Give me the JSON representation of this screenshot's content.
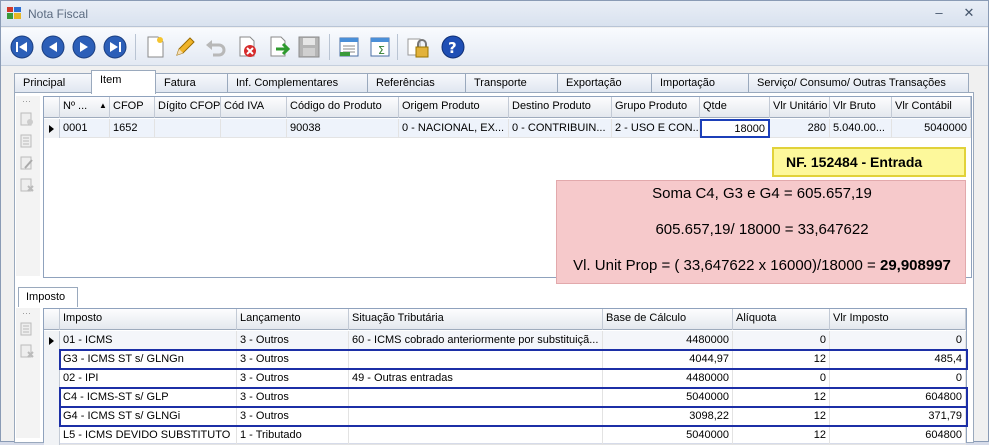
{
  "window": {
    "title": "Nota Fiscal",
    "minimize": "‒",
    "close": "✕"
  },
  "toolbar": {
    "buttons": [
      {
        "icon": "first-record-icon"
      },
      {
        "icon": "previous-record-icon"
      },
      {
        "icon": "next-record-icon"
      },
      {
        "icon": "last-record-icon"
      },
      {
        "icon": "new-document-icon"
      },
      {
        "icon": "edit-pencil-icon"
      },
      {
        "icon": "undo-icon"
      },
      {
        "icon": "delete-icon"
      },
      {
        "icon": "confirm-icon"
      },
      {
        "icon": "save-disk-icon"
      },
      {
        "icon": "report-icon"
      },
      {
        "icon": "sum-report-icon"
      },
      {
        "icon": "lock-icon"
      },
      {
        "icon": "help-icon"
      }
    ]
  },
  "tabs": [
    {
      "label": "Principal"
    },
    {
      "label": "Item"
    },
    {
      "label": "Fatura"
    },
    {
      "label": "Inf. Complementares"
    },
    {
      "label": "Referências"
    },
    {
      "label": "Transporte"
    },
    {
      "label": "Exportação"
    },
    {
      "label": "Importação"
    },
    {
      "label": "Serviço/ Consumo/ Outras Transações"
    }
  ],
  "item_grid": {
    "columns": [
      "Nº ...",
      "CFOP",
      "Dígito CFOP",
      "Cód IVA",
      "Código do Produto",
      "Origem Produto",
      "Destino Produto",
      "Grupo Produto",
      "Qtde",
      "Vlr Unitário",
      "Vlr Bruto",
      "Vlr Contábil"
    ],
    "rows": [
      [
        "0001",
        "1652",
        "",
        "",
        "90038",
        "0 - NACIONAL, EX...",
        "0 - CONTRIBUIN...",
        "2 - USO E CON...",
        "18000",
        "280",
        "5.040.00...",
        "5040000"
      ]
    ]
  },
  "annotation": {
    "banner": "NF. 152484 - Entrada",
    "line1": "Soma C4, G3 e G4 = 605.657,19",
    "line2": "605.657,19/ 18000 = 33,647622",
    "line3_prefix": "Vl. Unit Prop = ( 33,647622 x 16000)/18000 = ",
    "line3_result": "29,908997"
  },
  "lower_tab": {
    "label": "Imposto"
  },
  "tax_grid": {
    "columns": [
      "Imposto",
      "Lançamento",
      "Situação Tributária",
      "Base de Cálculo",
      "Alíquota",
      "Vlr Imposto"
    ],
    "rows": [
      [
        "01 - ICMS",
        "3 - Outros",
        "60 - ICMS cobrado anteriormente por substituiçã...",
        "4480000",
        "0",
        "0"
      ],
      [
        "G3 - ICMS ST s/ GLNGn",
        "3 - Outros",
        "",
        "4044,97",
        "12",
        "485,4"
      ],
      [
        "02 - IPI",
        "3 - Outros",
        "49 - Outras entradas",
        "4480000",
        "0",
        "0"
      ],
      [
        "C4 - ICMS-ST s/ GLP",
        "3 - Outros",
        "",
        "5040000",
        "12",
        "604800"
      ],
      [
        "G4 - ICMS ST s/ GLNGi",
        "3 - Outros",
        "",
        "3098,22",
        "12",
        "371,79"
      ],
      [
        "L5 - ICMS DEVIDO SUBSTITUTO",
        "1 - Tributado",
        "",
        "5040000",
        "12",
        "604800"
      ]
    ]
  }
}
